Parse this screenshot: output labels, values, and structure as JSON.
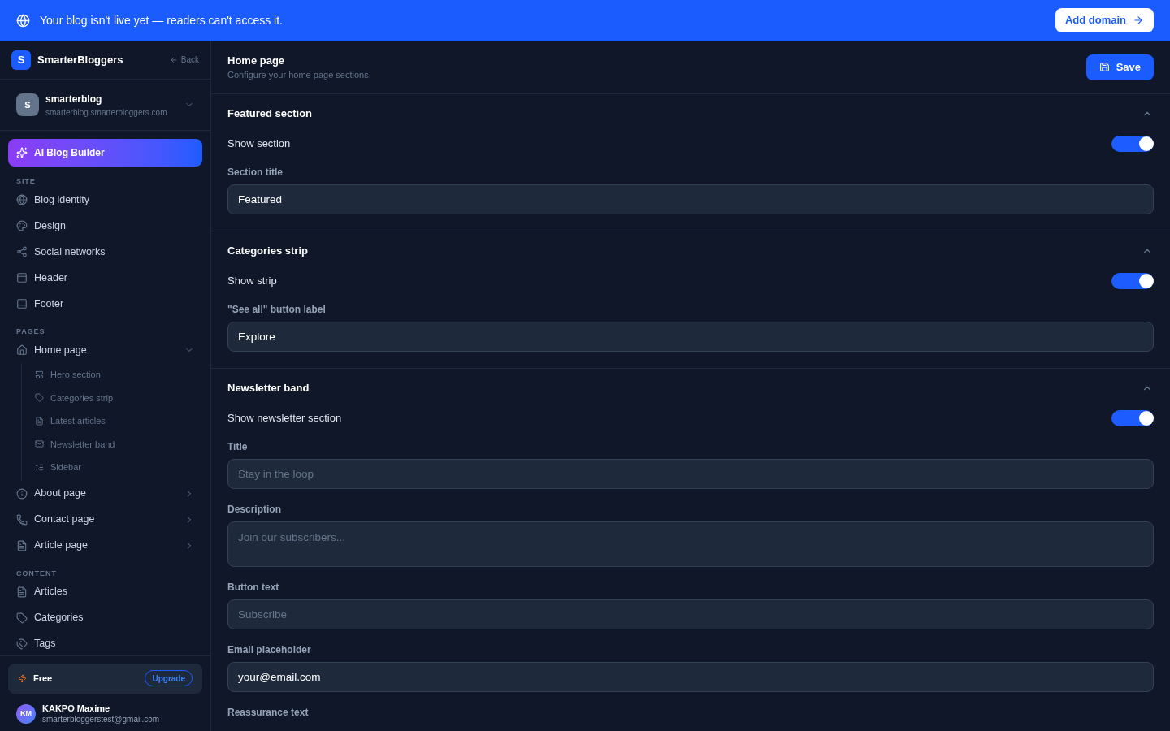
{
  "banner": {
    "message": "Your blog isn't live yet — readers can't access it.",
    "action": "Add domain"
  },
  "sidebar": {
    "brand": {
      "logo": "S",
      "name": "SmarterBloggers",
      "back": "Back"
    },
    "workspace": {
      "avatar": "S",
      "name": "smarterblog",
      "domain": "smarterblog.smarterbloggers.com"
    },
    "ai_button": "AI Blog Builder",
    "groups": [
      {
        "heading": "SITE",
        "items": [
          {
            "label": "Blog identity"
          },
          {
            "label": "Design"
          },
          {
            "label": "Social networks"
          },
          {
            "label": "Header"
          },
          {
            "label": "Footer"
          }
        ]
      },
      {
        "heading": "PAGES",
        "items": [
          {
            "label": "Home page",
            "expanded": true,
            "children": [
              {
                "label": "Hero section"
              },
              {
                "label": "Categories strip"
              },
              {
                "label": "Latest articles"
              },
              {
                "label": "Newsletter band"
              },
              {
                "label": "Sidebar"
              }
            ]
          },
          {
            "label": "About page",
            "expanded": false
          },
          {
            "label": "Contact page",
            "expanded": false
          },
          {
            "label": "Article page",
            "expanded": false
          }
        ]
      },
      {
        "heading": "CONTENT",
        "items": [
          {
            "label": "Articles"
          },
          {
            "label": "Categories"
          },
          {
            "label": "Tags"
          }
        ]
      }
    ],
    "plan": {
      "name": "Free",
      "action": "Upgrade"
    },
    "user": {
      "initials": "KM",
      "name": "KAKPO Maxime",
      "email": "smarterbloggerstest@gmail.com"
    }
  },
  "page": {
    "title": "Home page",
    "subtitle": "Configure your home page sections.",
    "save": "Save"
  },
  "sections": [
    {
      "title": "Featured section",
      "expanded": true,
      "fields": [
        {
          "kind": "toggle",
          "label": "Show section",
          "on": true
        },
        {
          "kind": "input",
          "label": "Section title",
          "value": "Featured"
        }
      ]
    },
    {
      "title": "Categories strip",
      "expanded": true,
      "fields": [
        {
          "kind": "toggle",
          "label": "Show strip",
          "on": true
        },
        {
          "kind": "input",
          "label": "\"See all\" button label",
          "value": "Explore"
        }
      ]
    },
    {
      "title": "Newsletter band",
      "expanded": true,
      "fields": [
        {
          "kind": "toggle",
          "label": "Show newsletter section",
          "on": true
        },
        {
          "kind": "input",
          "label": "Title",
          "placeholder": "Stay in the loop"
        },
        {
          "kind": "textarea",
          "label": "Description",
          "placeholder": "Join our subscribers..."
        },
        {
          "kind": "input",
          "label": "Button text",
          "placeholder": "Subscribe"
        },
        {
          "kind": "input",
          "label": "Email placeholder",
          "value": "your@email.com"
        },
        {
          "kind": "label",
          "label": "Reassurance text"
        }
      ]
    }
  ]
}
